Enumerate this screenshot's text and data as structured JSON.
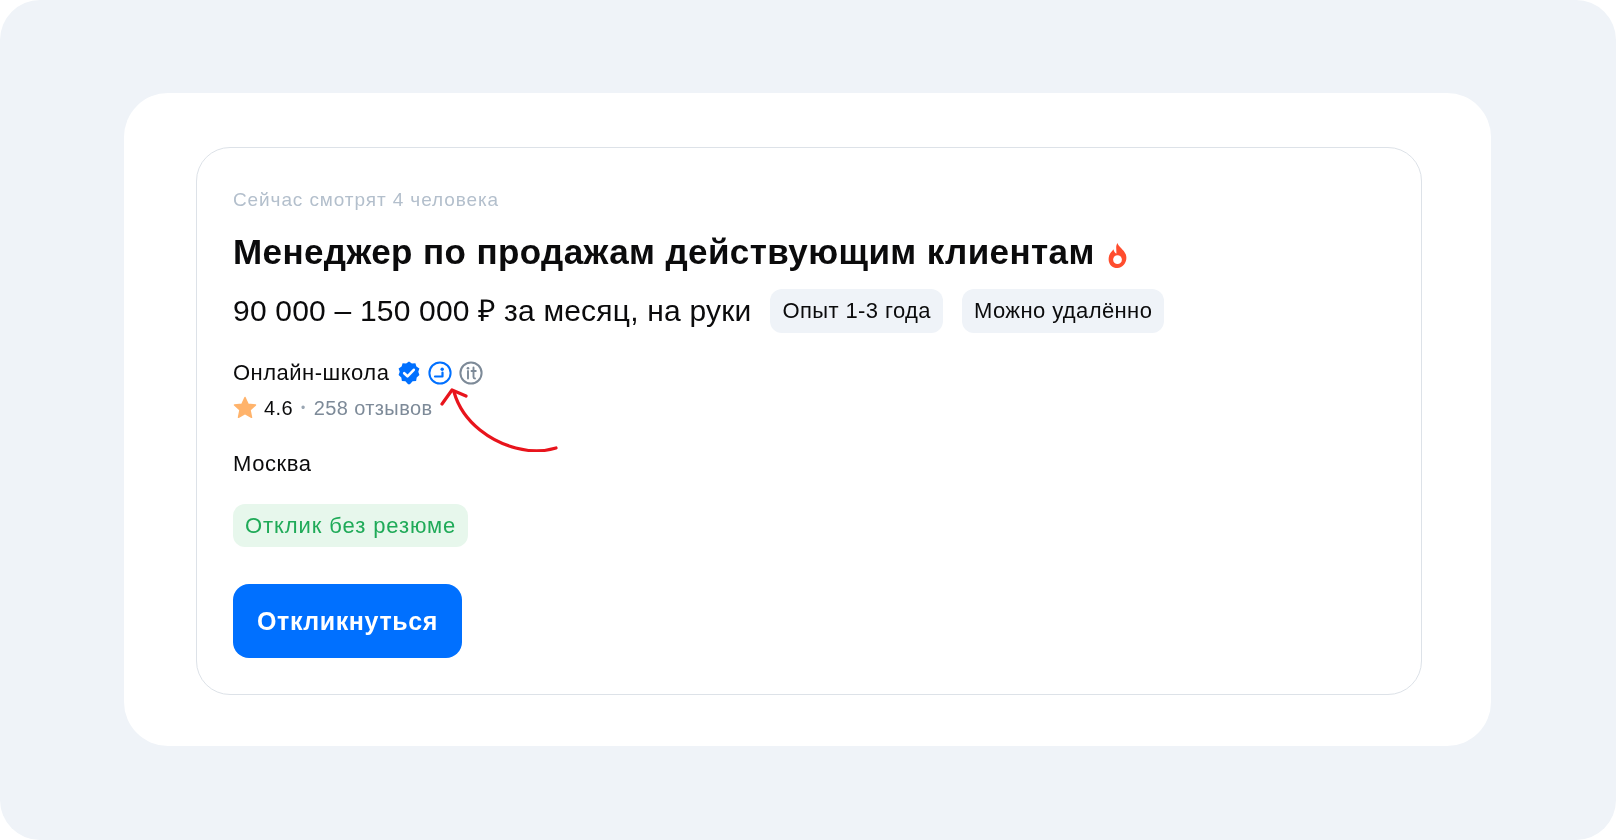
{
  "vacancy": {
    "viewers": "Сейчас смотрят 4 человека",
    "title": "Менеджер по продажам действующим клиентам",
    "hot": true,
    "salary": "90 000 – 150 000 ₽ за месяц, на руки",
    "tags": [
      {
        "label": "Опыт 1-3 года"
      },
      {
        "label": "Можно удалённо"
      }
    ],
    "company": {
      "name": "Онлайн-школа",
      "verified": true,
      "badges": [
        {
          "kind": "accredited"
        },
        {
          "kind": "it"
        }
      ],
      "rating": "4.6",
      "separator": "•",
      "reviews": "258 отзывов"
    },
    "location": "Москва",
    "response_note": "Отклик без резюме",
    "apply_button": "Откликнуться"
  }
}
